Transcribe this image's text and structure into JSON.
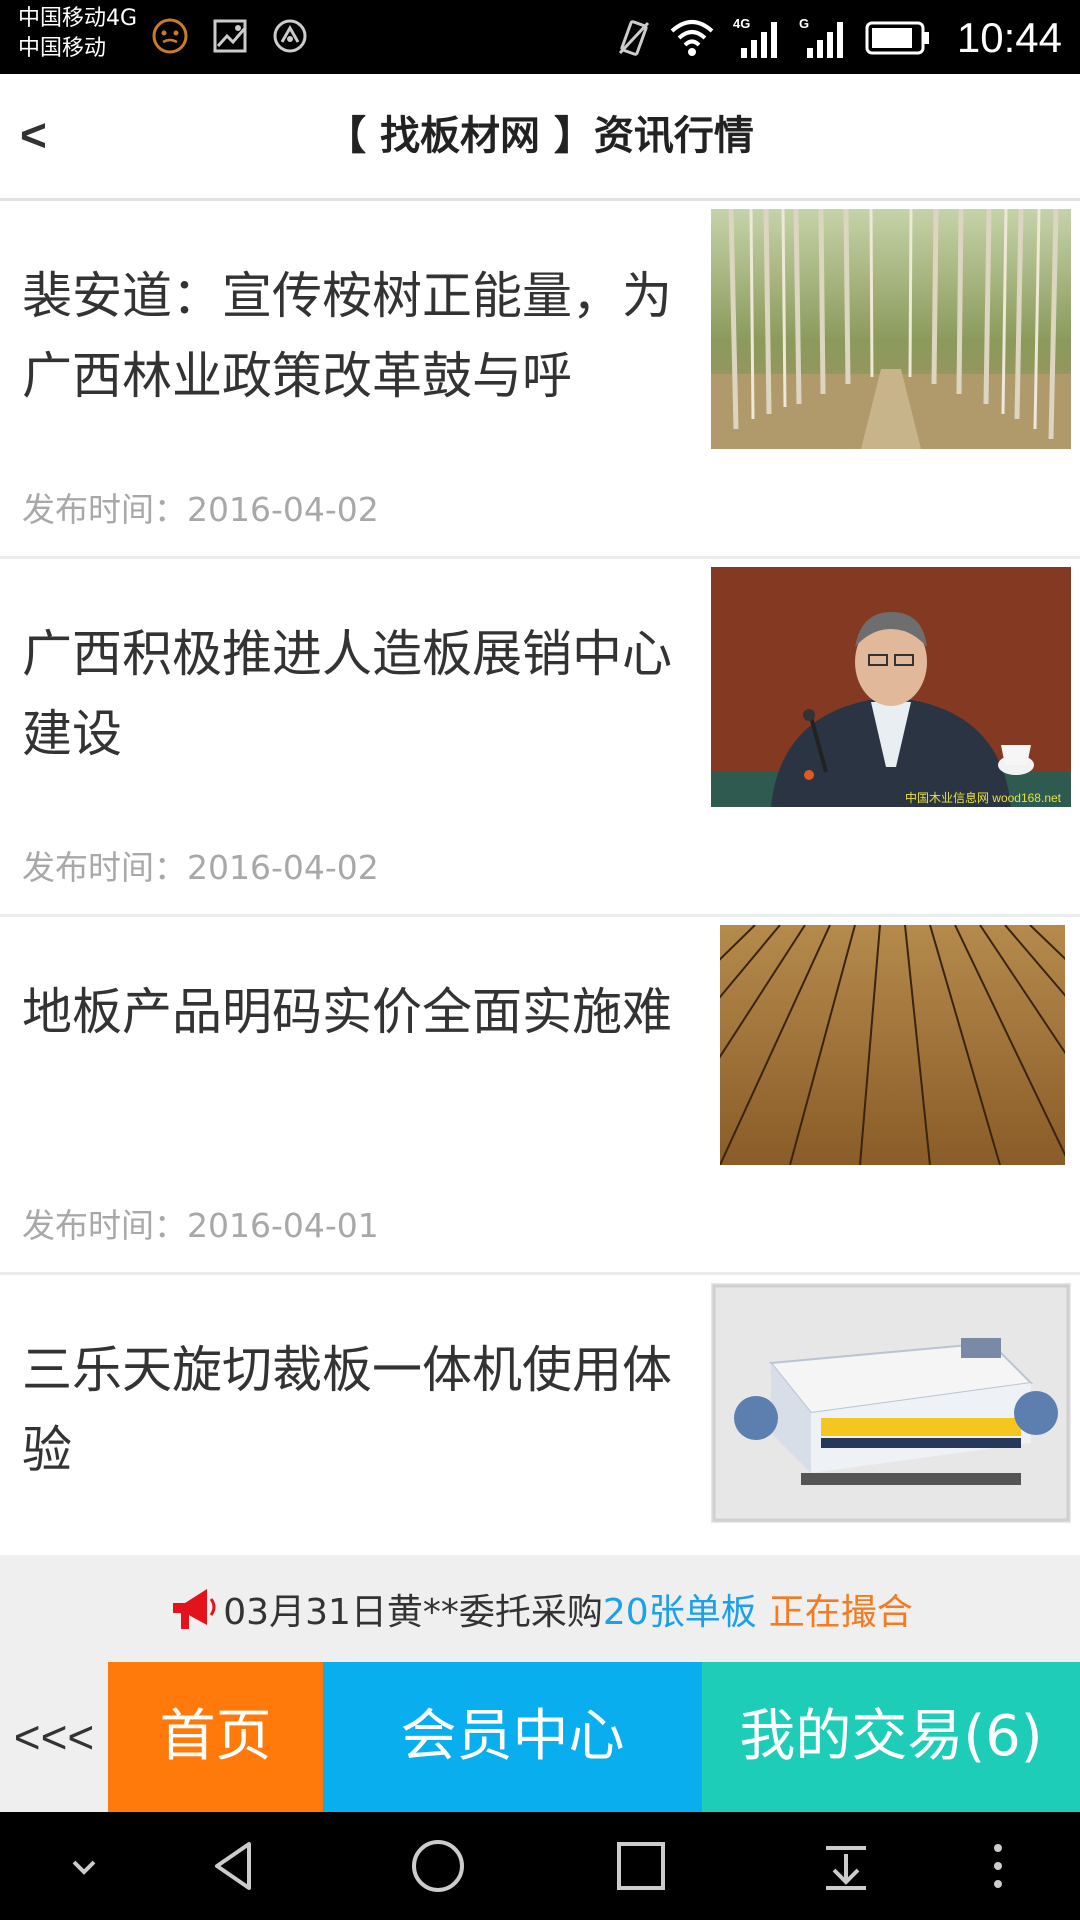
{
  "status_bar": {
    "carrier_line1": "中国移动4G",
    "carrier_line2": "中国移动",
    "left_icons": [
      "face-icon",
      "image-icon",
      "app-icon"
    ],
    "right_icons": [
      "vibrate-icon",
      "wifi-icon",
      "signal-4g-icon",
      "signal-g-icon",
      "battery-icon"
    ],
    "time": "10:44"
  },
  "header": {
    "back_label": "<",
    "title": "【 找板材网 】资讯行情"
  },
  "news": [
    {
      "title": "裴安道：宣传桉树正能量，为广西林业政策改革鼓与呼",
      "date": "发布时间：2016-04-02",
      "image": "eucalyptus-forest"
    },
    {
      "title": "广西积极推进人造板展销中心建设",
      "date": "发布时间：2016-04-02",
      "image": "man-at-microphone",
      "image_watermark": "中国木业信息网 wood168.net"
    },
    {
      "title": "地板产品明码实价全面实施难",
      "date": "发布时间：2016-04-01",
      "image": "wood-floor"
    },
    {
      "title": "三乐天旋切裁板一体机使用体验",
      "date": "",
      "image": "veneer-machine"
    }
  ],
  "ticker": {
    "icon": "megaphone-icon",
    "prefix": "03月31日黄**委托采购",
    "highlight": "20张单板",
    "status": "正在撮合"
  },
  "bottom_nav": {
    "more": "<<<",
    "home": "首页",
    "member": "会员中心",
    "trade": "我的交易(6)"
  },
  "colors": {
    "home": "#ff7a0a",
    "member": "#09aeee",
    "trade": "#1dcdb8",
    "ticker_highlight": "#1ca0e6",
    "ticker_status": "#f47b20"
  },
  "system_nav": [
    "collapse-icon",
    "back-triangle-icon",
    "home-circle-icon",
    "recents-square-icon",
    "notification-pull-icon",
    "overflow-menu-icon"
  ]
}
